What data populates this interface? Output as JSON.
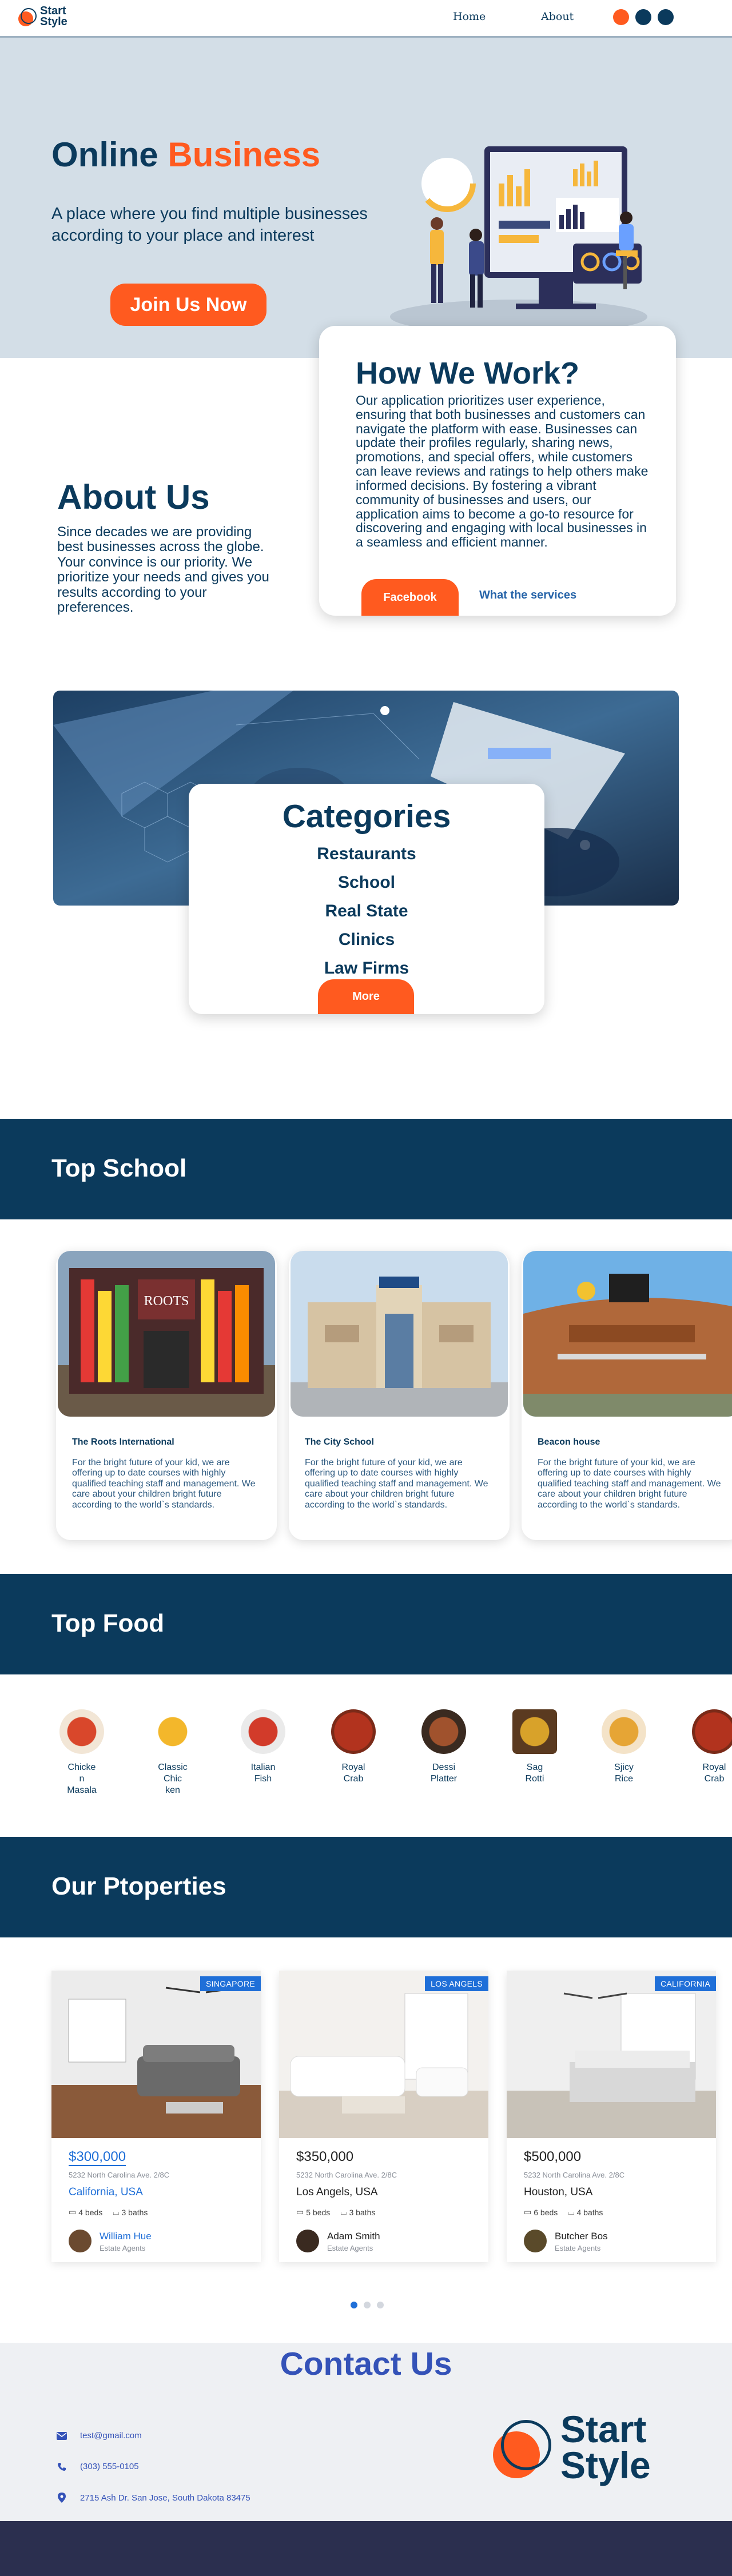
{
  "brand": {
    "line1": "Start",
    "line2": "Style"
  },
  "nav": {
    "links": [
      "Home",
      "About"
    ],
    "swatches": [
      "#ff5a1f",
      "#0b3a5c",
      "#0b3a5c"
    ]
  },
  "hero": {
    "title_part1": "Online",
    "title_part2": "Business",
    "subtitle": "A place where you find multiple businesses according to your place and interest",
    "cta": "Join Us Now"
  },
  "how": {
    "title": "How We Work?",
    "body": "Our application prioritizes user experience, ensuring that both businesses and customers can navigate the platform with ease. Businesses can update their profiles regularly, sharing news, promotions, and special offers, while customers can leave reviews and ratings to help others make informed decisions. By fostering a vibrant community of businesses and users, our application aims to become a go-to resource for discovering and engaging with local businesses in a seamless and efficient manner.",
    "primary_button": "Facebook",
    "secondary_link": "What the services"
  },
  "about": {
    "title": "About Us",
    "body": "Since decades we are providing best businesses across the globe. Your convince is our priority. We prioritize your needs and gives you results according to your preferences."
  },
  "categories": {
    "title": "Categories",
    "items": [
      "Restaurants",
      "School",
      "Real State",
      "Clinics",
      "Law Firms"
    ],
    "more": "More"
  },
  "schools": {
    "title": "Top School",
    "items": [
      {
        "name": "The Roots International",
        "desc": "For the bright future of your kid, we are offering up to date courses with highly qualified  teaching staff and management. We care about your children bright future according to the world`s standards."
      },
      {
        "name": "The City School",
        "desc": "For the bright future of your kid, we are offering up to date courses with highly qualified  teaching staff and management. We care about your children bright future according to the world`s standards."
      },
      {
        "name": "Beacon house",
        "desc": "For the bright future of your kid, we are offering up to date courses with highly qualified  teaching staff and management. We care about your children bright future according to the world`s standards."
      }
    ]
  },
  "food": {
    "title": "Top Food",
    "items": [
      {
        "label": "Chicke\nn\nMasala"
      },
      {
        "label": "Classic\nChic\nken"
      },
      {
        "label": "Italian\nFish"
      },
      {
        "label": "Royal\nCrab"
      },
      {
        "label": "Dessi\nPlatter"
      },
      {
        "label": "Sag\nRotti"
      },
      {
        "label": "Sjicy\nRice"
      },
      {
        "label": "Royal\nCrab"
      }
    ]
  },
  "properties": {
    "title": "Our Ptoperties",
    "items": [
      {
        "tag": "SINGAPORE",
        "price": "$300,000",
        "address": "5232 North Carolina Ave. 2/8C",
        "city": "California, USA",
        "beds": "4 beds",
        "baths": "3 baths",
        "agent": "William Hue",
        "role": "Estate Agents",
        "highlight": true
      },
      {
        "tag": "LOS ANGELS",
        "price": "$350,000",
        "address": "5232 North Carolina Ave. 2/8C",
        "city": "Los Angels, USA",
        "beds": "5 beds",
        "baths": "3 baths",
        "agent": "Adam Smith",
        "role": "Estate Agents",
        "highlight": false
      },
      {
        "tag": "CALIFORNIA",
        "price": "$500,000",
        "address": "5232 North Carolina Ave. 2/8C",
        "city": "Houston, USA",
        "beds": "6 beds",
        "baths": "4 baths",
        "agent": "Butcher Bos",
        "role": "Estate Agents",
        "highlight": false
      }
    ]
  },
  "contact": {
    "title": "Contact Us",
    "email": "test@gmail.com",
    "phone": "(303) 555-0105",
    "address": "2715 Ash Dr. San Jose, South Dakota 83475"
  }
}
